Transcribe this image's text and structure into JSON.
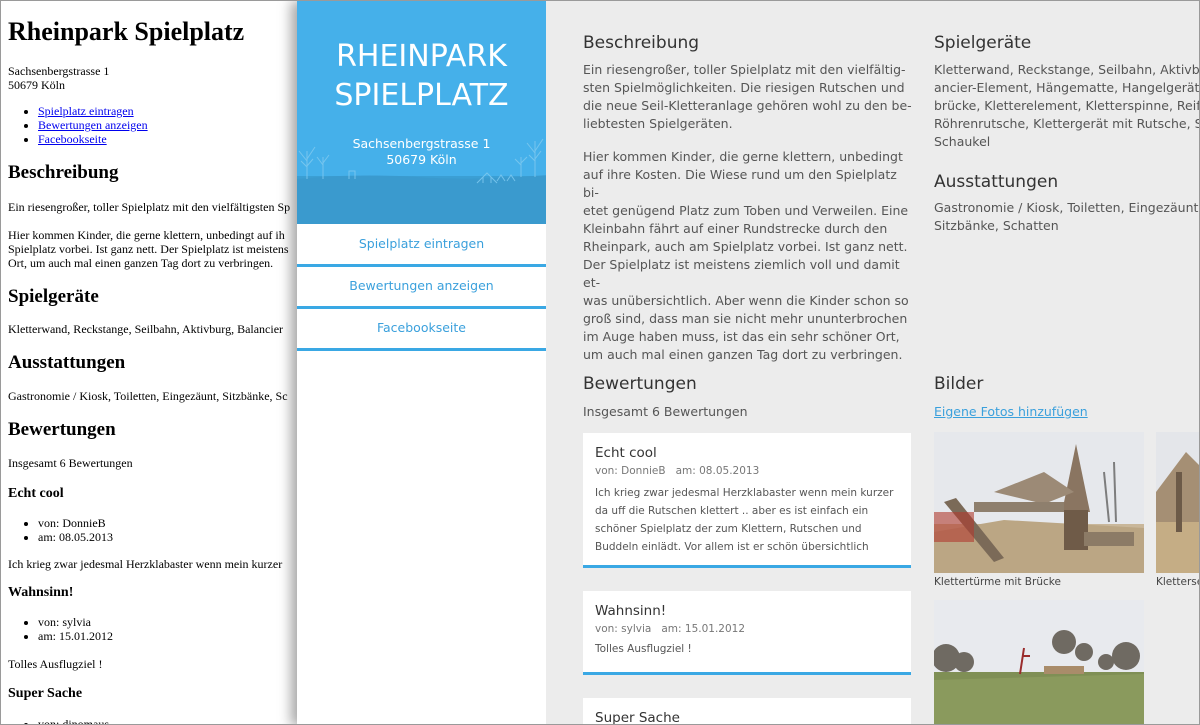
{
  "plain": {
    "title": "Rheinpark Spielplatz",
    "address_street": "Sachsenbergstrasse 1",
    "address_city": "50679 Köln",
    "links": [
      "Spielplatz eintragen",
      "Bewertungen anzeigen",
      "Facebookseite"
    ],
    "h_beschreibung": "Beschreibung",
    "beschreibung_p1": "Ein riesengroßer, toller Spielplatz mit den vielfältigsten Sp",
    "beschreibung_p2_l1": "Hier kommen Kinder, die gerne klettern, unbedingt auf ih",
    "beschreibung_p2_l2": "Spielplatz vorbei. Ist ganz nett. Der Spielplatz ist meistens",
    "beschreibung_p2_l3": "Ort, um auch mal einen ganzen Tag dort zu verbringen.",
    "h_spielgeraete": "Spielgeräte",
    "spielgeraete": "Kletterwand, Reckstange, Seilbahn, Aktivburg, Balancier",
    "h_ausstattungen": "Ausstattungen",
    "ausstattungen": "Gastronomie / Kiosk, Toiletten, Eingezäunt, Sitzbänke, Sc",
    "h_bewertungen": "Bewertungen",
    "insgesamt": "Insgesamt 6 Bewertungen",
    "reviews": [
      {
        "title": "Echt cool",
        "von": "von: DonnieB",
        "am": "am: 08.05.2013",
        "text": "Ich krieg zwar jedesmal Herzklabaster wenn mein kurzer"
      },
      {
        "title": "Wahnsinn!",
        "von": "von: sylvia",
        "am": "am: 15.01.2012",
        "text": "Tolles Ausflugziel !"
      },
      {
        "title": "Super Sache",
        "von": "von: dinomaus"
      }
    ]
  },
  "sidebar": {
    "title_line1": "RHEINPARK",
    "title_line2": "SPIELPLATZ",
    "street": "Sachsenbergstrasse 1",
    "city": "50679 Köln",
    "nav": [
      "Spielplatz eintragen",
      "Bewertungen anzeigen",
      "Facebookseite"
    ],
    "accent": "#3aa8e4"
  },
  "main": {
    "beschreibung": {
      "heading": "Beschreibung",
      "p1": "Ein riesengroßer, toller Spielplatz mit den vielfältig-\nsten Spielmöglichkeiten. Die riesigen Rutschen und\ndie neue Seil-Kletteranlage gehören wohl zu den be-\nliebtesten Spielgeräten.",
      "p2": "Hier kommen Kinder, die gerne klettern, unbedingt\nauf ihre Kosten. Die Wiese rund um den Spielplatz bi-\netet genügend Platz zum Toben und Verweilen. Eine\nKleinbahn fährt auf einer Rundstrecke durch den\nRheinpark, auch am Spielplatz vorbei. Ist ganz nett.\nDer Spielplatz ist meistens ziemlich voll und damit et-\nwas unübersichtlich. Aber wenn die Kinder schon so\ngroß sind, dass man sie nicht mehr ununterbrochen\nim Auge haben muss, ist das ein sehr schöner Ort,\num auch mal einen ganzen Tag dort zu verbringen."
    },
    "spielgeraete": {
      "heading": "Spielgeräte",
      "text": "Kletterwand, Reckstange, Seilbahn, Aktivbu\nancier-Element, Hängematte, Hangelgerät, \nbrücke, Kletterelement, Kletterspinne, Reifen\nRöhrenrutsche, Klettergerät mit Rutsche, Sa\nSchaukel"
    },
    "ausstattungen": {
      "heading": "Ausstattungen",
      "text": "Gastronomie / Kiosk, Toiletten, Eingezäunt,\nSitzbänke, Schatten"
    },
    "bewertungen": {
      "heading": "Bewertungen",
      "count": "Insgesamt 6 Bewertungen",
      "reviews": [
        {
          "title": "Echt cool",
          "author": "von: DonnieB",
          "date": "am: 08.05.2013",
          "text": "Ich krieg zwar jedesmal Herzklabaster wenn mein kurzer da uff die Rutschen klettert .. aber es ist einfach ein schöner Spielplatz der zum Klettern, Rutschen und Buddeln einlädt. Vor allem ist er schön übersichtlich"
        },
        {
          "title": "Wahnsinn!",
          "author": "von: sylvia",
          "date": "am: 15.01.2012",
          "text": "Tolles Ausflugziel !"
        },
        {
          "title": "Super Sache"
        }
      ]
    },
    "bilder": {
      "heading": "Bilder",
      "add_link": "Eigene Fotos hinzufügen",
      "captions": [
        "Klettertürme mit Brücke",
        "Kletterse"
      ]
    }
  }
}
